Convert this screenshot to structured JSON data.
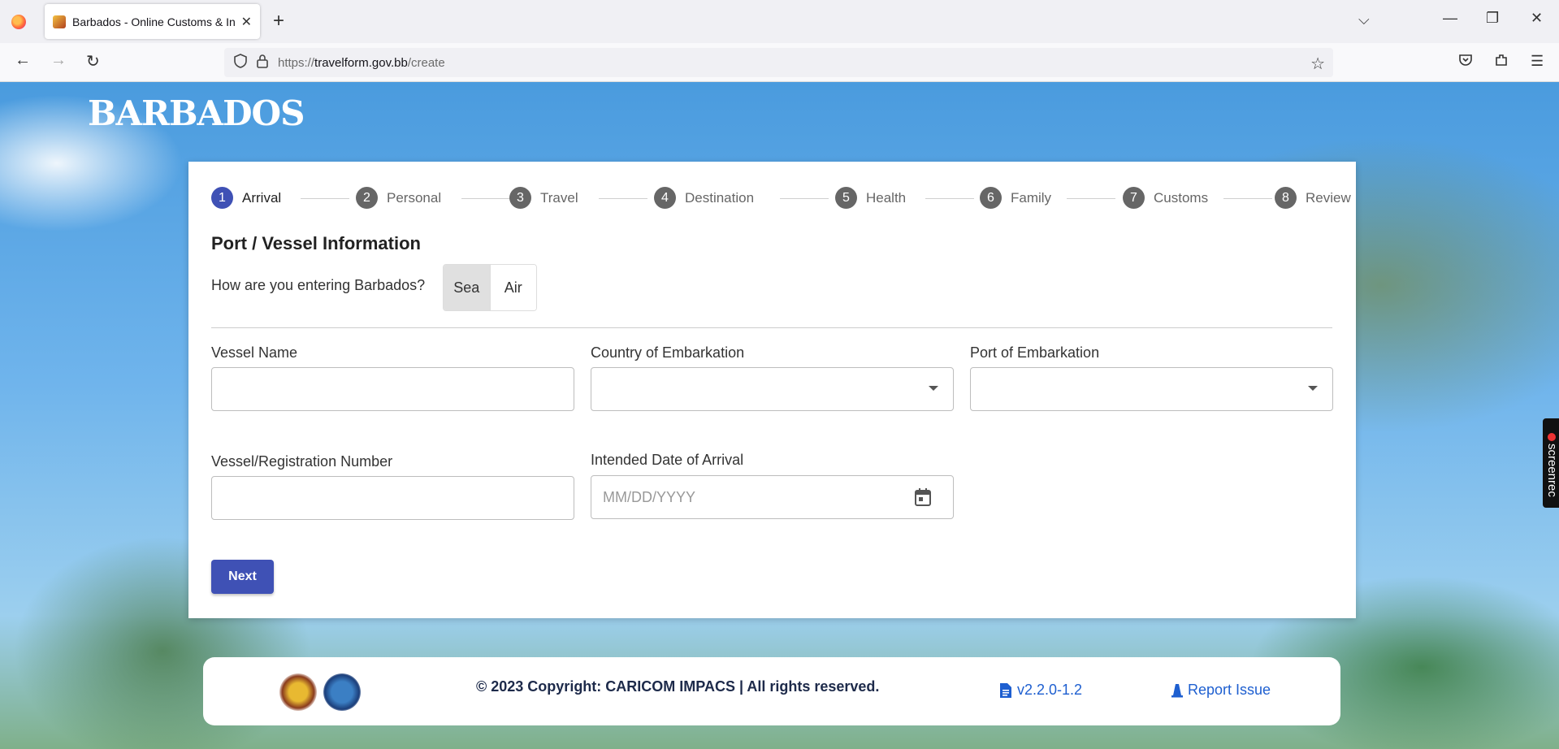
{
  "browser": {
    "tab_title": "Barbados - Online Customs & In",
    "url_scheme": "https://",
    "url_host": "travelform.gov.bb",
    "url_path": "/create"
  },
  "page": {
    "logo_text": "BARBADOS",
    "steps": [
      {
        "num": "1",
        "label": "Arrival",
        "active": true
      },
      {
        "num": "2",
        "label": "Personal"
      },
      {
        "num": "3",
        "label": "Travel"
      },
      {
        "num": "4",
        "label": "Destination"
      },
      {
        "num": "5",
        "label": "Health"
      },
      {
        "num": "6",
        "label": "Family"
      },
      {
        "num": "7",
        "label": "Customs"
      },
      {
        "num": "8",
        "label": "Review"
      }
    ],
    "section_title": "Port / Vessel Information",
    "entry_question": "How are you entering Barbados?",
    "entry_options": [
      "Sea",
      "Air"
    ],
    "entry_selected": "Sea",
    "fields": {
      "vessel_name_label": "Vessel Name",
      "country_label": "Country of Embarkation",
      "port_label": "Port of Embarkation",
      "registration_label": "Vessel/Registration Number",
      "arrival_date_label": "Intended Date of Arrival",
      "arrival_date_placeholder": "MM/DD/YYYY"
    },
    "next_label": "Next"
  },
  "footer": {
    "copyright": "© 2023 Copyright: CARICOM IMPACS | All rights reserved.",
    "version": "v2.2.0-1.2",
    "report": "Report Issue"
  },
  "overlay": {
    "screenrec": "screenrec"
  },
  "colors": {
    "accent": "#3f51b5",
    "link": "#1e5fd0"
  }
}
